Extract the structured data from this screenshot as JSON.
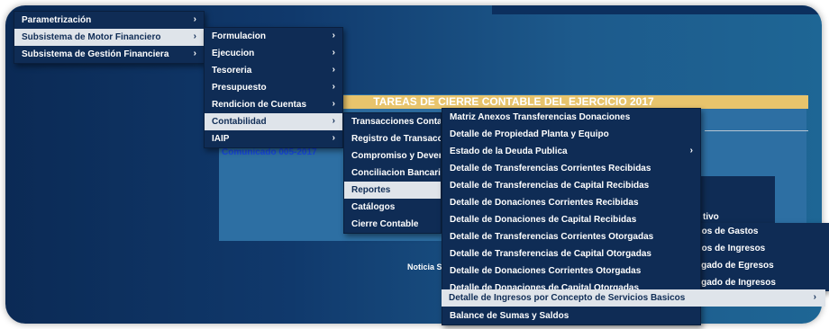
{
  "menu_l1": [
    {
      "label": "Parametrización",
      "arrow": "›"
    },
    {
      "label": "Subsistema de Motor Financiero",
      "arrow": "›"
    },
    {
      "label": "Subsistema de Gestión Financiera",
      "arrow": "›"
    }
  ],
  "menu_l2": [
    {
      "label": "Formulacion",
      "arrow": "›"
    },
    {
      "label": "Ejecucion",
      "arrow": "›"
    },
    {
      "label": "Tesoreria",
      "arrow": "›"
    },
    {
      "label": "Presupuesto",
      "arrow": "›"
    },
    {
      "label": "Rendicion de Cuentas",
      "arrow": "›"
    },
    {
      "label": "Contabilidad",
      "arrow": "›"
    },
    {
      "label": "IAIP",
      "arrow": "›"
    }
  ],
  "menu_l3": [
    {
      "label": "Transacciones Contables",
      "arrow": "›"
    },
    {
      "label": "Registro de Transacciones",
      "arrow": "›"
    },
    {
      "label": "Compromiso y Devengado",
      "arrow": "›"
    },
    {
      "label": "Conciliacion Bancaria",
      "arrow": "›"
    },
    {
      "label": "Reportes",
      "arrow": "›"
    },
    {
      "label": "Catálogos",
      "arrow": "›"
    },
    {
      "label": "Cierre Contable",
      "arrow": "›"
    }
  ],
  "menu_l4": [
    {
      "label": "Matriz Anexos Transferencias Donaciones",
      "arrow": ""
    },
    {
      "label": "Detalle de Propiedad Planta y Equipo",
      "arrow": ""
    },
    {
      "label": "Estado de la Deuda Publica",
      "arrow": "›"
    },
    {
      "label": "Detalle de Transferencias Corrientes Recibidas",
      "arrow": ""
    },
    {
      "label": "Detalle de Transferencias de Capital Recibidas",
      "arrow": ""
    },
    {
      "label": "Detalle de Donaciones Corrientes Recibidas",
      "arrow": ""
    },
    {
      "label": "Detalle de Donaciones de Capital Recibidas",
      "arrow": ""
    },
    {
      "label": "Detalle de Transferencias Corrientes Otorgadas",
      "arrow": ""
    },
    {
      "label": "Detalle de Transferencias de Capital Otorgadas",
      "arrow": ""
    },
    {
      "label": "Detalle de Donaciones Corrientes Otorgadas",
      "arrow": ""
    },
    {
      "label": "Detalle de Donaciones de Capital Otorgadas",
      "arrow": ""
    },
    {
      "label": "Detalle de Ingresos por Concepto de Servicios Basicos",
      "arrow": "›"
    },
    {
      "label": "Balance de Sumas y Saldos",
      "arrow": ""
    }
  ],
  "content": {
    "title": "TAREAS DE CIERRE CONTABLE DEL EJERCICIO 2017",
    "comunicado": "Comunicado 005-2017",
    "noticia": "Noticia Si",
    "partial_panel_text": "tivo"
  },
  "right_menu": [
    {
      "label": "rios de Gastos"
    },
    {
      "label": "rios de Ingresos"
    },
    {
      "label": "ngado de Egresos"
    },
    {
      "label": "ngado de Ingresos"
    }
  ],
  "colors": {
    "menu_bg": "#0f2c55",
    "selected_bg": "#dfe4ea",
    "title_bar": "#e8c46c",
    "link": "#1846e0"
  }
}
